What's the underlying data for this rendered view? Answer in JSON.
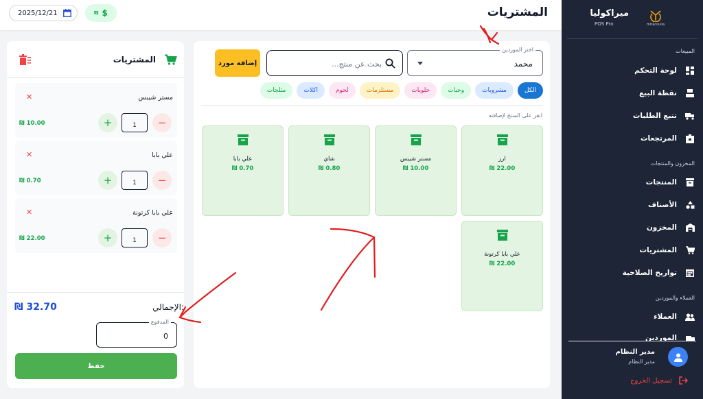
{
  "sidebar": {
    "brand": {
      "name": "ميراكوليا",
      "tag": "POS Pro",
      "logo_text": "miracoulia"
    },
    "sections": [
      {
        "title": "المبيعات"
      },
      {
        "title": "المخزون والمنتجات"
      },
      {
        "title": "العملاء والموردين"
      }
    ],
    "items": [
      {
        "label": "لوحة التحكم",
        "icon": "dashboard-icon"
      },
      {
        "label": "نقطة البيع",
        "icon": "pos-register-icon"
      },
      {
        "label": "تتبع الطلبات",
        "icon": "truck-icon"
      },
      {
        "label": "المرتجعات",
        "icon": "returns-icon"
      },
      {
        "label": "المنتجات",
        "icon": "archive-box-icon"
      },
      {
        "label": "الأصناف",
        "icon": "categories-icon"
      },
      {
        "label": "المخزون",
        "icon": "warehouse-icon"
      },
      {
        "label": "المشتريات",
        "icon": "cart-icon"
      },
      {
        "label": "تواريخ الصلاحية",
        "icon": "calendar-icon"
      },
      {
        "label": "العملاء",
        "icon": "people-icon"
      },
      {
        "label": "الموردين",
        "icon": "supplier-icon"
      }
    ],
    "user": {
      "name": "مدير النظام",
      "role": "مدير النظام"
    },
    "logout": "تسجيل الخروج"
  },
  "header": {
    "title": "المشتريات",
    "date": "2025/12/21",
    "currency_small": "₪",
    "currency_big": "$"
  },
  "main": {
    "supplier": {
      "label": "اختر الموردين",
      "value": "محمد"
    },
    "search": {
      "placeholder": "بحث عن منتج..."
    },
    "add_supplier": "إضافة مورد",
    "categories": [
      {
        "label": "الكل",
        "bg": "#1976d2",
        "fg": "#ffffff"
      },
      {
        "label": "مشروبات",
        "bg": "#dbeafe",
        "fg": "#2563eb"
      },
      {
        "label": "وجبات",
        "bg": "#dcfce7",
        "fg": "#16a34a"
      },
      {
        "label": "حلويات",
        "bg": "#fce7f3",
        "fg": "#db2777"
      },
      {
        "label": "مستلزمات",
        "bg": "#fef3c7",
        "fg": "#d97706"
      },
      {
        "label": "لحوم",
        "bg": "#fce7f3",
        "fg": "#db2777"
      },
      {
        "label": "اكلات",
        "bg": "#dbeafe",
        "fg": "#2563eb"
      },
      {
        "label": "مثلجات",
        "bg": "#dcfce7",
        "fg": "#16a34a"
      }
    ],
    "hint": "انقر على المنتج لإضافته",
    "products": [
      {
        "name": "ارز",
        "price": "₪ 22.00"
      },
      {
        "name": "مستر شيبس",
        "price": "₪ 10.00"
      },
      {
        "name": "شاي",
        "price": "₪ 0.80"
      },
      {
        "name": "علي بابا",
        "price": "₪ 0.70"
      },
      {
        "name": "علي بابا كرتونة",
        "price": "₪ 22.00"
      }
    ]
  },
  "cart": {
    "title": "المشتريات",
    "items": [
      {
        "name": "مستر شيبس",
        "qty": "1",
        "price": "₪ 10.00"
      },
      {
        "name": "علي بابا",
        "qty": "1",
        "price": "₪ 0.70"
      },
      {
        "name": "علي بابا كرتونة",
        "qty": "1",
        "price": "₪ 22.00"
      }
    ],
    "remove": "✕",
    "plus": "+",
    "minus": "−",
    "total_label": "الإجمالي:",
    "total_value": "₪ 32.70",
    "paid_label": "المدفوع",
    "paid_value": "0",
    "save": "حفظ"
  },
  "colors": {
    "sidebar": "#1e2536",
    "accent": "#4caf50",
    "primary": "#1976d2",
    "annotation": "#e11d1d"
  }
}
